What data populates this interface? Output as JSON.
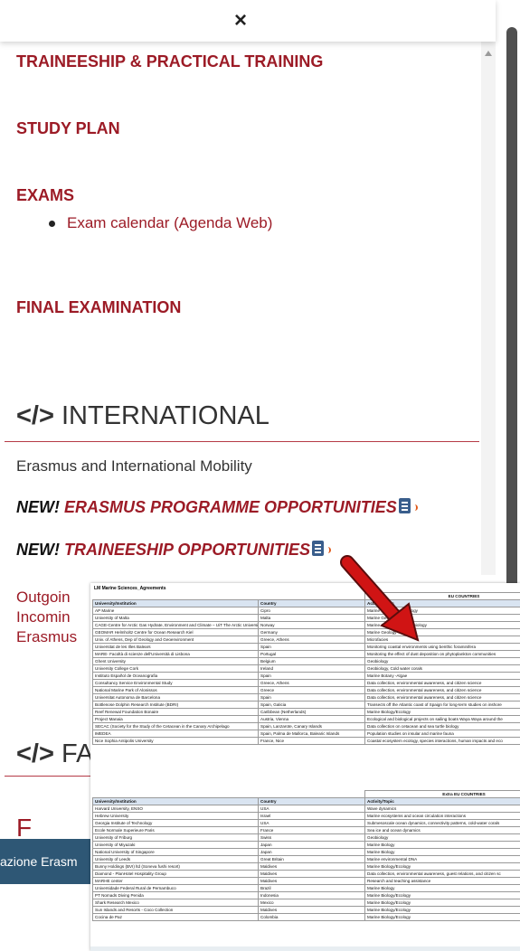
{
  "top": {
    "close_glyph": "×"
  },
  "sections": {
    "traineeship": "TRAINEESHIP & PRACTICAL TRAINING",
    "study_plan": "STUDY PLAN",
    "exams": "EXAMS",
    "exam_link": "Exam calendar (Agenda Web)",
    "final": "FINAL EXAMINATION"
  },
  "international": {
    "icon": "</>",
    "title": "INTERNATIONAL",
    "intro": "Erasmus and International Mobility",
    "new_label": "NEW!",
    "erasmus_link": "ERASMUS PROGRAMME OPPORTUNITIES",
    "traineeship_link": "TRAINEESHIP OPPORTUNITIES",
    "outgoing_partial": "Outgoin",
    "incoming_partial": "Incomin",
    "erasmus_partial": "Erasmus",
    "fa_icon": "</>",
    "fa_partial": "FA",
    "bottom_partial": "F"
  },
  "footer_bar": {
    "text": "azione Erasm"
  },
  "sheet": {
    "title": "LM Marine Sciences_Agreements",
    "eu_header": "EU COUNTRIES",
    "extra_header": "Extra EU COUNTRIES",
    "columns": [
      "University/Institution",
      "Country",
      "Activity/Topic"
    ],
    "eu_rows": [
      [
        "AP Marine",
        "Cipro",
        "Marine ecology and biology"
      ],
      [
        "University of Malta",
        "Malta",
        "Marine Geology"
      ],
      [
        "CAGE-Centre for Arctic Gas Hydrate, Environment and Climate – UiT The Arctic University of Norway Norway",
        "Norway",
        "Marine Geology and Geobiology"
      ],
      [
        "GEOMAR Helmholtz Centre for Ocean Research Kiel",
        "Germany",
        "Marine Geology"
      ],
      [
        "Univ. of Athens, Dep of Geology and Geoenvironment",
        "Greece, Athens",
        "Microfacies"
      ],
      [
        "Universitat de les Illes Balears",
        "Spain",
        "Monitoring coastal environments using benthic foraminifera"
      ],
      [
        "MARE- Facoltà di scienze dell'Università di Lisbona",
        "Portugal",
        "Monitoring the effect of dust deposition on phytoplankton communities"
      ],
      [
        "Ghent University",
        "Belgium",
        "Geobiology"
      ],
      [
        "University College Cork",
        "Ireland",
        "Geobiology, Cold water corals"
      ],
      [
        "Instituto Español de Oceanografia",
        "Spain",
        "Marine Botany -Algae"
      ],
      [
        "Consultancy Service Environmental Study",
        "Greece, Athens",
        "Data collection, environmental awareness, and citizen science"
      ],
      [
        "National Marine Park of Alonissos",
        "Greece",
        "Data collection, environmental awareness, and citizen science"
      ],
      [
        "Universitat Autonoma de Barcelona",
        "Spain",
        "Data collection, environmental awareness, and citizen science"
      ],
      [
        "Bottlenose Dolphin Research Institute (BDRI)",
        "Spain, Galicia",
        "Transects off the Atlantic coast of Spaign for long-term studies on inshore"
      ],
      [
        "Reef Renewal Foundation Bonaire",
        "Caribbean (Netherlands)",
        "Marine Biology/Ecology"
      ],
      [
        "Project Manaia",
        "Austria, Vienna",
        "Ecological and biological projects on sailing boats Waya Waya around the"
      ],
      [
        "SECAC (Society for the Study of the Cetacean in the Canary Archipelago",
        "Spain, Lanzarote, Canary Islands",
        "Data collection on cetacean and sea turtle biology"
      ],
      [
        "IMEDEA",
        "Spain, Palma de Mallorca, Balearic Islands",
        "Population studies on insular and marine fauna"
      ],
      [
        "Nice Sophia Antipolis University",
        "France, Nice",
        "Coastal ecosystem ecology, species interactions, human impacts and eco"
      ]
    ],
    "extra_rows": [
      [
        "Harvard University, ENSO",
        "USA",
        "Wave dynamics"
      ],
      [
        "Hebrew University",
        "Israel",
        "Marine ecosystems and ocean circulation interactions"
      ],
      [
        "Georgia Institute of Technology",
        "USA",
        "Submesoscale ocean dynamics, connectivity patterns, cold-water corals"
      ],
      [
        "Ecole Normale Superieure Paris",
        "France",
        "Sea ice and ocean dynamics"
      ],
      [
        "University of Friburg",
        "Swiss",
        "Geobiology"
      ],
      [
        "University of Miyazaki",
        "Japan",
        "Marine Biology"
      ],
      [
        "National University of Singapore",
        "Japan",
        "Marine Biology"
      ],
      [
        "University of Leeds",
        "Great Britain",
        "Marine environmental DNA"
      ],
      [
        "Bunny Holdings (BVI) ltd (Soneva fushi resort)",
        "Maldives",
        "Marine Biology/Ecology"
      ],
      [
        "Diamond - PlanHotel Hospitality Group",
        "Maldives",
        "Data collection, environmental awareness, guest relations, and citizen sc"
      ],
      [
        "MARHE center",
        "Maldives",
        "Research and teaching assistance"
      ],
      [
        "Universidade Federal Rural de Pernambuco",
        "Brazil",
        "Marine Biology"
      ],
      [
        "PT Nomads Diving Penida",
        "Indonesia",
        "Marine Biology/Ecology"
      ],
      [
        "Shark Research Mexico",
        "Mexico",
        "Marine Biology/Ecology"
      ],
      [
        "Sun Islands and Resorts - Coco Collection",
        "Maldives",
        "Marine Biology/Ecology"
      ],
      [
        "Cocina de Paz",
        "Colombia",
        "Marine Biology/Ecology"
      ]
    ]
  },
  "colors": {
    "accent": "#9c1b26",
    "footer": "#2e5775",
    "arrow": "#d01414"
  }
}
